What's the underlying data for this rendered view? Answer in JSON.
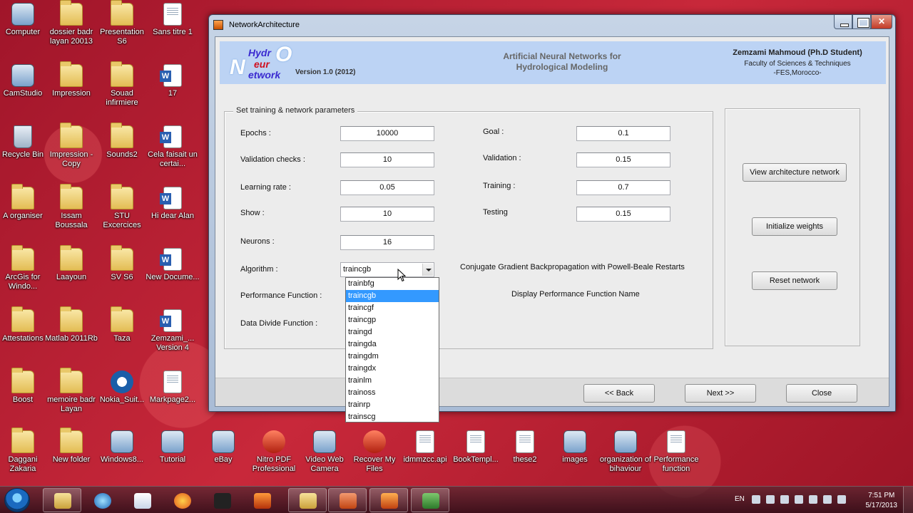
{
  "desktop": {
    "icons": [
      {
        "label": "Computer",
        "type": "app"
      },
      {
        "label": "dossier badr layan 20013",
        "type": "folder"
      },
      {
        "label": "Presentation S6",
        "type": "folder"
      },
      {
        "label": "Sans titre 1",
        "type": "doc"
      },
      {
        "label": "CamStudio",
        "type": "app"
      },
      {
        "label": "Impression",
        "type": "folder"
      },
      {
        "label": "Souad infirmiere",
        "type": "folder"
      },
      {
        "label": "17",
        "type": "word"
      },
      {
        "label": "Recycle Bin",
        "type": "bin"
      },
      {
        "label": "Impression - Copy",
        "type": "folder"
      },
      {
        "label": "Sounds2",
        "type": "folder"
      },
      {
        "label": "Cela faisait un certai...",
        "type": "word"
      },
      {
        "label": "A organiser",
        "type": "folder"
      },
      {
        "label": "Issam Boussala",
        "type": "folder"
      },
      {
        "label": "STU Excercices",
        "type": "folder"
      },
      {
        "label": "Hi dear Alan",
        "type": "word"
      },
      {
        "label": "ArcGis for Windo...",
        "type": "folder"
      },
      {
        "label": "Laayoun",
        "type": "folder"
      },
      {
        "label": "SV S6",
        "type": "folder"
      },
      {
        "label": "New Docume...",
        "type": "word"
      },
      {
        "label": "Attestations",
        "type": "folder"
      },
      {
        "label": "Matlab 2011Rb",
        "type": "folder"
      },
      {
        "label": "Taza",
        "type": "folder"
      },
      {
        "label": "Zemzami_... Version 4",
        "type": "word"
      },
      {
        "label": "Boost",
        "type": "folder"
      },
      {
        "label": "memoire badr Layan",
        "type": "folder"
      },
      {
        "label": "Nokia_Suit...",
        "type": "circ"
      },
      {
        "label": "Markpage2...",
        "type": "doc"
      },
      {
        "label": "Daggani Zakaria",
        "type": "folder"
      },
      {
        "label": "New folder",
        "type": "folder"
      },
      {
        "label": "Windows8...",
        "type": "app"
      },
      {
        "label": "Tutorial",
        "type": "app"
      },
      {
        "label": "eBay",
        "type": "app"
      },
      {
        "label": "Nitro PDF Professional",
        "type": "red"
      },
      {
        "label": "Video Web Camera",
        "type": "app"
      },
      {
        "label": "Recover My Files",
        "type": "red"
      },
      {
        "label": "idmmzcc.api",
        "type": "doc"
      },
      {
        "label": "BookTempl...",
        "type": "doc"
      },
      {
        "label": "these2",
        "type": "doc"
      },
      {
        "label": "images",
        "type": "app"
      },
      {
        "label": "organization of bihaviour",
        "type": "app"
      },
      {
        "label": "Performance function",
        "type": "doc"
      }
    ]
  },
  "window": {
    "title": "NetworkArchitecture",
    "close_glyph": "✕"
  },
  "header": {
    "logo": {
      "hydr": "Hydr",
      "o": "O",
      "eur": "eur",
      "n": "N",
      "etwork": "etwork"
    },
    "version": "Version 1.0 (2012)",
    "center_line1": "Artificial Neural Networks for",
    "center_line2": "Hydrological Modeling",
    "author": "Zemzami Mahmoud (Ph.D Student)",
    "affiliation1": "Faculty of Sciences & Techniques",
    "affiliation2": "-FES,Morocco-"
  },
  "params": {
    "legend": "Set training & network parameters",
    "epochs_label": "Epochs :",
    "epochs_value": "10000",
    "validation_checks_label": "Validation checks :",
    "validation_checks_value": "10",
    "learning_rate_label": "Learning rate :",
    "learning_rate_value": "0.05",
    "show_label": "Show :",
    "show_value": "10",
    "neurons_label": "Neurons :",
    "neurons_value": "16",
    "algorithm_label": "Algorithm :",
    "algorithm_value": "traincgb",
    "performance_label": "Performance Function :",
    "divide_label": "Data Divide Function :",
    "goal_label": "Goal :",
    "goal_value": "0.1",
    "validation_label": "Validation :",
    "validation_value": "0.15",
    "training_label": "Training :",
    "training_value": "0.7",
    "testing_label": "Testing",
    "testing_value": "0.15",
    "algorithm_description": "Conjugate Gradient Backpropagation with Powell-Beale Restarts",
    "performance_description": "Display Performance Function Name"
  },
  "algorithm_options": [
    "trainbfg",
    "traincgb",
    "traincgf",
    "traincgp",
    "traingd",
    "traingda",
    "traingdm",
    "traingdx",
    "trainlm",
    "trainoss",
    "trainrp",
    "trainscg"
  ],
  "side_buttons": {
    "view": "View architecture network",
    "init": "Initialize weights",
    "reset": "Reset network"
  },
  "footer_buttons": {
    "back": "<< Back",
    "next": "Next >>",
    "close": "Close"
  },
  "taskbar": {
    "lang": "EN",
    "time": "7:51 PM",
    "date": "5/17/2013"
  },
  "colors": {
    "header_bg": "#bcd3f4",
    "selection": "#3399ff",
    "desktop": "#b01f2c"
  }
}
